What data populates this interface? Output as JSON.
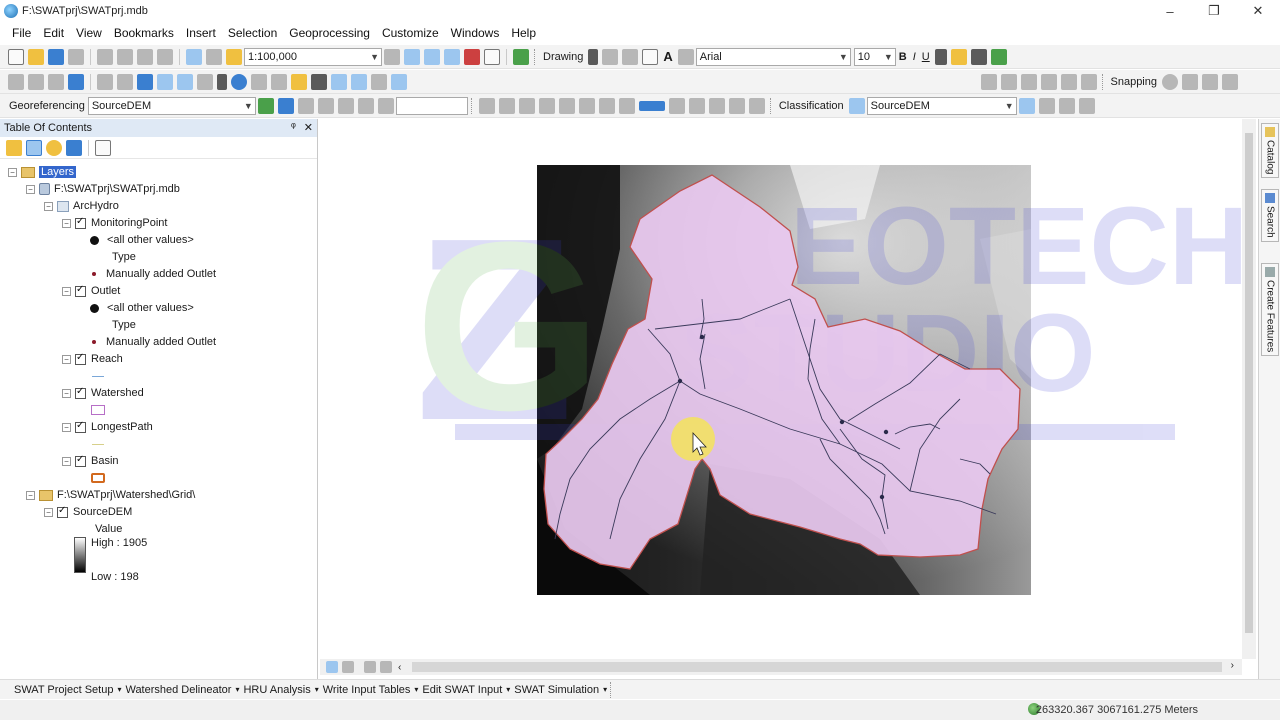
{
  "window": {
    "title": "F:\\SWATprj\\SWATprj.mdb",
    "minimize": "–",
    "maximize": "❐",
    "close": "✕"
  },
  "menu": [
    "File",
    "Edit",
    "View",
    "Bookmarks",
    "Insert",
    "Selection",
    "Geoprocessing",
    "Customize",
    "Windows",
    "Help"
  ],
  "toolbar": {
    "scale": "1:100,000",
    "drawing_label": "Drawing",
    "font_name": "Arial",
    "font_size": "10",
    "bold": "B",
    "italic": "I",
    "underline": "U",
    "text_tool": "A",
    "snapping_label": "Snapping",
    "georeferencing_label": "Georeferencing",
    "georef_layer": "SourceDEM",
    "classification_label": "Classification",
    "classification_layer": "SourceDEM"
  },
  "toc": {
    "title": "Table Of Contents",
    "pin": "ᵠ",
    "close": "✕",
    "layers_label": "Layers",
    "db_path": "F:\\SWATprj\\SWATprj.mdb",
    "dataset": "ArcHydro",
    "monitoring_point": "MonitoringPoint",
    "all_other_values": "<all other values>",
    "type_heading": "Type",
    "manual_outlet": "Manually added Outlet",
    "outlet": "Outlet",
    "reach": "Reach",
    "watershed": "Watershed",
    "longest_path": "LongestPath",
    "basin": "Basin",
    "grid_path": "F:\\SWATprj\\Watershed\\Grid\\",
    "source_dem": "SourceDEM",
    "value_label": "Value",
    "high_label": "High : 1905",
    "low_label": "Low : 198"
  },
  "side_tabs": [
    "Catalog",
    "Search",
    "Create Features"
  ],
  "swat_toolbar": [
    "SWAT Project Setup",
    "Watershed Delineator",
    "HRU Analysis",
    "Write Input Tables",
    "Edit SWAT Input",
    "SWAT Simulation"
  ],
  "status": {
    "coordinates": "263320.367  3067161.275 Meters"
  },
  "watermark": {
    "letter": "G",
    "word1": "EOTECH",
    "word2": "STUDIO"
  },
  "colors": {
    "watershed_fill": "#e8c8ef",
    "boundary": "#c0504d",
    "stream": "#3a3a5a",
    "selection": "#3366cc",
    "watermark_green": "#5ab04b",
    "watermark_blue": "#3b3bd6"
  }
}
